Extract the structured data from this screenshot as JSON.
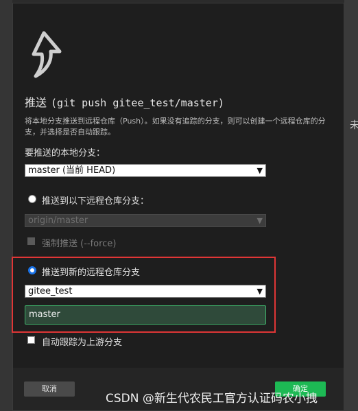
{
  "background": {
    "right_text": "未"
  },
  "dialog": {
    "title": "推送",
    "command": "(git push gitee_test/master)",
    "description": "将本地分支推送到远程仓库（Push）。如果没有追踪的分支，则可以创建一个远程仓库的分支，并选择是否自动跟踪。",
    "local_branch_label": "要推送的本地分支：",
    "local_branch_value": "master (当前 HEAD)",
    "push_existing_label": "推送到以下远程仓库分支：",
    "existing_remote_value": "origin/master",
    "force_label": "强制推送 (--force)",
    "push_new_label": "推送到新的远程仓库分支",
    "new_remote_value": "gitee_test",
    "new_branch_name": "master",
    "track_upstream_label": "自动跟踪为上游分支",
    "cancel_label": "取消",
    "ok_label": "确定"
  },
  "watermark": "CSDN @新生代农民工官方认证码农小拽",
  "colors": {
    "accent_green": "#1db954",
    "selection_red": "#e03636",
    "radio_blue": "#1a73e8"
  }
}
